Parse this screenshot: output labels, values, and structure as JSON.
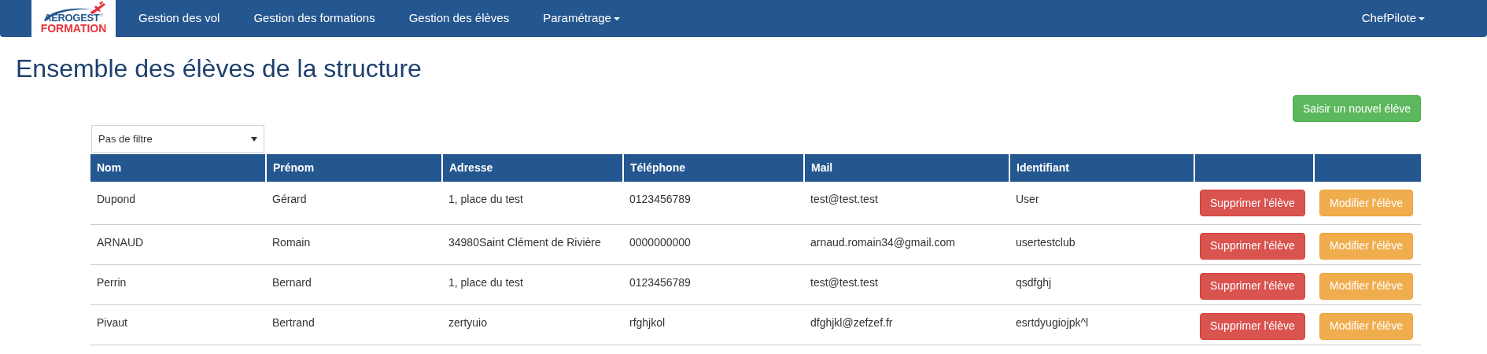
{
  "navbar": {
    "logo": {
      "line_1": "AEROGEST",
      "registered": "®",
      "line_2": "FORMATION"
    },
    "items": [
      {
        "label": "Gestion des vol",
        "dropdown": false
      },
      {
        "label": "Gestion des formations",
        "dropdown": false
      },
      {
        "label": "Gestion des élèves",
        "dropdown": false
      },
      {
        "label": "Paramétrage",
        "dropdown": true
      }
    ],
    "user": {
      "label": "ChefPilote",
      "dropdown": true
    }
  },
  "page_title": "Ensemble des élèves de la structure",
  "new_button": "Saisir un nouvel élève",
  "filter": {
    "value": "Pas de filtre"
  },
  "table": {
    "columns": [
      "Nom",
      "Prénom",
      "Adresse",
      "Téléphone",
      "Mail",
      "Identifiant"
    ],
    "rows": [
      {
        "cells": [
          "Dupond",
          "Gérard",
          "1, place du test",
          "0123456789",
          "test@test.test",
          "User"
        ],
        "delete": "Supprimer l'élève",
        "edit": "Modifier l'élève"
      },
      {
        "cells": [
          "ARNAUD",
          "Romain",
          "34980Saint Clément de Rivière",
          "0000000000",
          "arnaud.romain34@gmail.com",
          "usertestclub"
        ],
        "delete": "Supprimer l'élève",
        "edit": "Modifier l'élève"
      },
      {
        "cells": [
          "Perrin",
          "Bernard",
          "1, place du test",
          "0123456789",
          "test@test.test",
          "qsdfghj"
        ],
        "delete": "Supprimer l'élève",
        "edit": "Modifier l'élève"
      },
      {
        "cells": [
          "Pivaut",
          "Bertrand",
          "zertyuio",
          "rfghjkol",
          "dfghjkl@zefzef.fr",
          "esrtdyugiojpk^l"
        ],
        "delete": "Supprimer l'élève",
        "edit": "Modifier l'élève"
      }
    ]
  }
}
